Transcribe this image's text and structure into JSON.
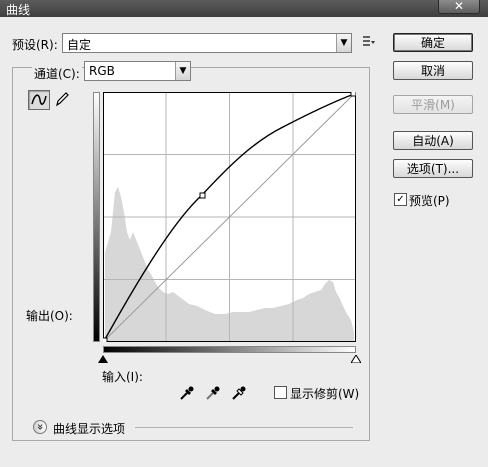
{
  "window": {
    "title": "曲线",
    "close_glyph": "✕"
  },
  "preset": {
    "label": "预设(R):",
    "value": "自定"
  },
  "channel": {
    "label": "通道(C):",
    "value": "RGB"
  },
  "graph": {
    "output_label": "输出(O):",
    "input_label": "输入(I):",
    "show_clipping_label": "显示修剪(W)",
    "show_clipping_checked": false
  },
  "buttons": {
    "ok": "确定",
    "cancel": "取消",
    "smooth": "平滑(M)",
    "auto": "自动(A)",
    "options": "选项(T)..."
  },
  "preview": {
    "label": "预览(P)",
    "checked": true,
    "check_glyph": "✓"
  },
  "curve_display": {
    "label": "曲线显示选项",
    "expand_glyph": "»"
  },
  "curve_points": [
    [
      0,
      0
    ],
    [
      102,
      155
    ],
    [
      255,
      255
    ]
  ],
  "colors": {
    "titlebar": "#4b4b4b",
    "histogram": "#d7d7d7",
    "curve": "#000000"
  }
}
